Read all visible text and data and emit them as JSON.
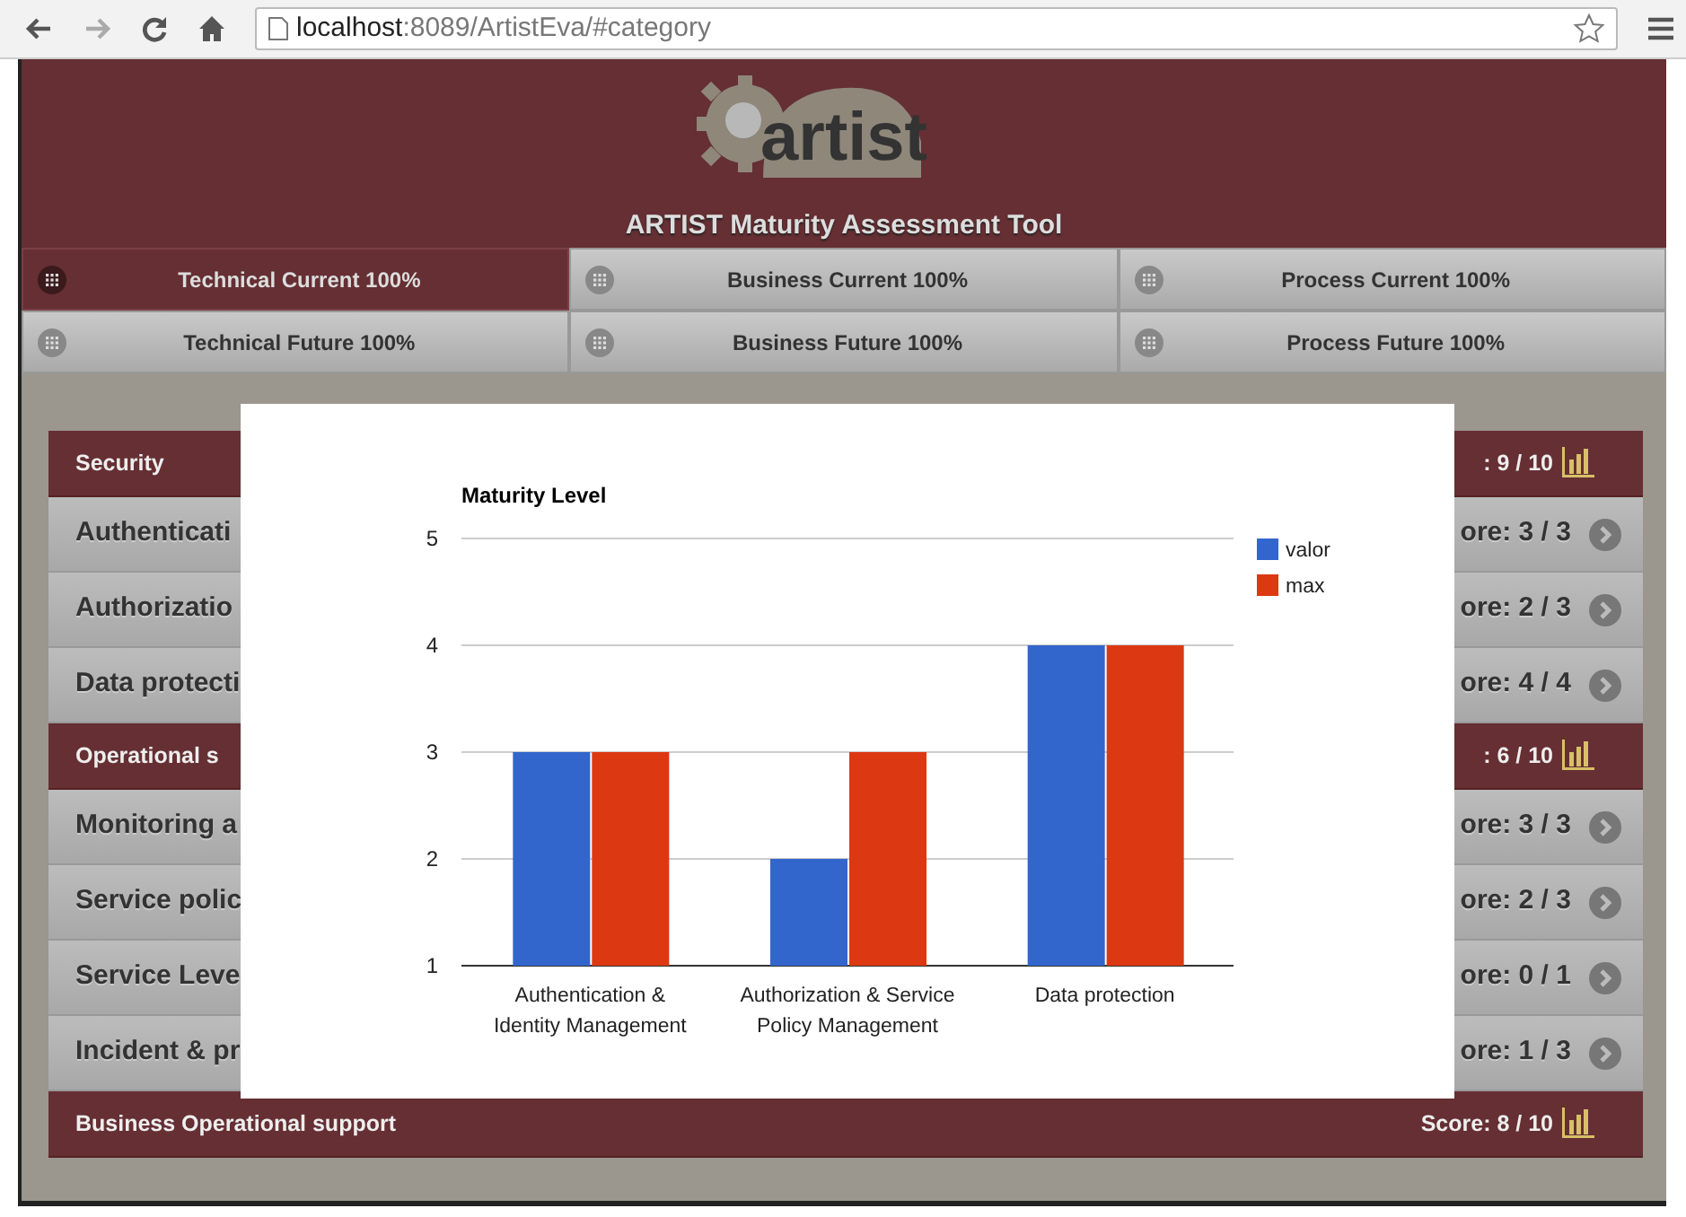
{
  "browser": {
    "url_host": "localhost",
    "url_path": ":8089/ArtistEva/#category"
  },
  "header": {
    "logo": "artist",
    "title": "ARTIST Maturity Assessment Tool"
  },
  "tabs": [
    {
      "label": "Technical Current 100%",
      "selected": true
    },
    {
      "label": "Business Current 100%",
      "selected": false
    },
    {
      "label": "Process Current 100%",
      "selected": false
    },
    {
      "label": "Technical Future 100%",
      "selected": false
    },
    {
      "label": "Business Future 100%",
      "selected": false
    },
    {
      "label": "Process Future 100%",
      "selected": false
    }
  ],
  "rows": [
    {
      "kind": "section",
      "name": "Security",
      "score": ": 9 / 10"
    },
    {
      "kind": "item",
      "name": "Authenticati",
      "score": "ore: 3 / 3"
    },
    {
      "kind": "item",
      "name": "Authorizatio",
      "score": "ore: 2 / 3"
    },
    {
      "kind": "item",
      "name": "Data protecti",
      "score": "ore: 4 / 4"
    },
    {
      "kind": "section",
      "name": "Operational s",
      "score": ": 6 / 10"
    },
    {
      "kind": "item",
      "name": "Monitoring a",
      "score": "ore: 3 / 3"
    },
    {
      "kind": "item",
      "name": "Service polic",
      "score": "ore: 2 / 3"
    },
    {
      "kind": "item",
      "name": "Service Leve",
      "score": "ore: 0 / 1"
    },
    {
      "kind": "item",
      "name": "Incident & pr",
      "score": "ore: 1 / 3"
    },
    {
      "kind": "section",
      "name": "Business Operational support",
      "score": "Score: 8 / 10"
    }
  ],
  "modal": {
    "chart_data": {
      "type": "bar",
      "title": "Maturity Level",
      "categories": [
        "Authentication & Identity Management",
        "Authorization & Service Policy Management",
        "Data protection"
      ],
      "grid": true,
      "legend": true,
      "series": [
        {
          "name": "valor",
          "color": "#3366cc",
          "values": [
            3,
            2,
            4
          ]
        },
        {
          "name": "max",
          "color": "#dc3912",
          "values": [
            3,
            3,
            4
          ]
        }
      ],
      "ylim": [
        1,
        5
      ],
      "yticks": [
        1,
        2,
        3,
        4,
        5
      ]
    }
  }
}
